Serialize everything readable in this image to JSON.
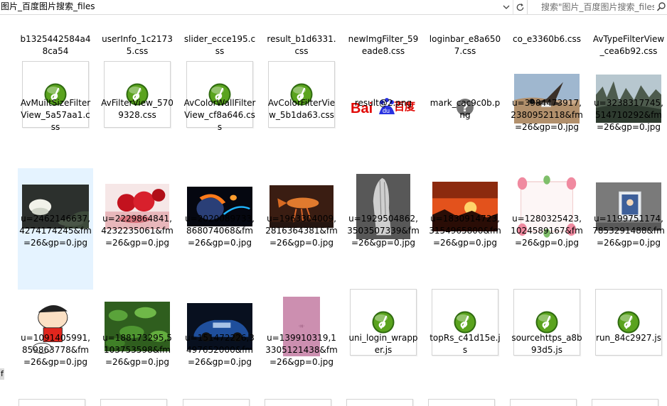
{
  "address_bar": {
    "path": "图片_百度图片搜索_files",
    "dropdown_icon": "chevron-down-icon",
    "refresh_icon": "refresh-icon"
  },
  "search": {
    "placeholder": "搜索\"图片_百度图片搜索_files\"",
    "icon": "search-icon"
  },
  "left_edge_text": "f",
  "files": [
    {
      "name": "b1325442584a48ca54",
      "kind": "file-top"
    },
    {
      "name": "userInfo_1c21735.css",
      "kind": "file-top"
    },
    {
      "name": "slider_ecce195.css",
      "kind": "file-top"
    },
    {
      "name": "result_b1d6331.css",
      "kind": "file-top"
    },
    {
      "name": "newImgFilter_59eade8.css",
      "kind": "file-top"
    },
    {
      "name": "loginbar_e8a6507.css",
      "kind": "file-top"
    },
    {
      "name": "co_e3360b6.css",
      "kind": "file-top"
    },
    {
      "name": "AvTypeFilterView_cea6b92.css",
      "kind": "file-top"
    },
    {
      "name": "AvMuiltSizeFilterView_5a57aa1.css",
      "kind": "dreamweaver"
    },
    {
      "name": "AvFilterView_5709328.css",
      "kind": "dreamweaver"
    },
    {
      "name": "AvColorWallFilterView_cf8a646.css",
      "kind": "dreamweaver"
    },
    {
      "name": "AvColorFilterView_5b1da63.css",
      "kind": "dreamweaver"
    },
    {
      "name": "result@2.png",
      "kind": "baidu-logo",
      "logo_text": "百度"
    },
    {
      "name": "mark_cac9c0b.png",
      "kind": "question-mark"
    },
    {
      "name": "u=3984473917,2380952118&fm=26&gp=0.jpg",
      "kind": "photo",
      "photo": "goose"
    },
    {
      "name": "u=3238317745,514710292&fm=26&gp=0.jpg",
      "kind": "photo",
      "photo": "mountains"
    },
    {
      "name": "u=2462146637,4274174245&fm=26&gp=0.jpg",
      "kind": "photo",
      "photo": "lotus",
      "selected": true
    },
    {
      "name": "u=2229864841,4232235061&fm=26&gp=0.jpg",
      "kind": "photo",
      "photo": "roses"
    },
    {
      "name": "u=2020089733,868074068&fm=26&gp=0.jpg",
      "kind": "photo",
      "photo": "planet"
    },
    {
      "name": "u=1963304009,2816364381&fm=26&gp=0.jpg",
      "kind": "photo",
      "photo": "fish"
    },
    {
      "name": "u=1929504862,3503507339&fm=26&gp=0.jpg",
      "kind": "photo",
      "photo": "hands"
    },
    {
      "name": "u=1830914723,3154965800&fm=26&gp=0.jpg",
      "kind": "photo",
      "photo": "sunset"
    },
    {
      "name": "u=1280325423,1024589167&fm=26&gp=0.jpg",
      "kind": "photo",
      "photo": "frame"
    },
    {
      "name": "u=1199751174,7853291488&fm=26&gp=0.jpg",
      "kind": "photo",
      "photo": "photoframe"
    },
    {
      "name": "u=1091405991,859863778&fm=26&gp=0.jpg",
      "kind": "photo",
      "photo": "cartoon"
    },
    {
      "name": "u=188173295,5103753598&fm=26&gp=0.jpg",
      "kind": "photo",
      "photo": "leaves"
    },
    {
      "name": "u=151472226,3497652000&fm=26&gp=0.jpg",
      "kind": "photo",
      "photo": "car"
    },
    {
      "name": "u=139910319,13305121438&fm=26&gp=0.jpg",
      "kind": "photo",
      "photo": "pink"
    },
    {
      "name": "uni_login_wrapper.js",
      "kind": "dreamweaver"
    },
    {
      "name": "topRs_c41d15e.js",
      "kind": "dreamweaver"
    },
    {
      "name": "sourcehttps_a8b93d5.js",
      "kind": "dreamweaver"
    },
    {
      "name": "run_84c2927.js",
      "kind": "dreamweaver"
    }
  ],
  "colors": {
    "selection": "#e5f3ff",
    "dreamweaver_green": "#5aa31e",
    "baidu_blue": "#2932e1",
    "baidu_red": "#e10602"
  }
}
